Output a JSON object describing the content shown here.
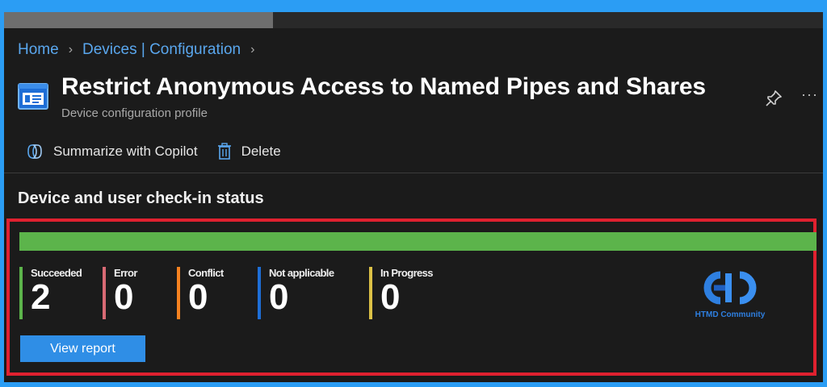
{
  "breadcrumb": [
    "Home",
    "Devices | Configuration"
  ],
  "header": {
    "title": "Restrict Anonymous Access to Named Pipes and Shares",
    "subtitle": "Device configuration profile",
    "more": "···"
  },
  "toolbar": {
    "copilot_label": "Summarize with Copilot",
    "delete_label": "Delete"
  },
  "section": {
    "title": "Device and user check-in status"
  },
  "status": {
    "progress_succeeded_fraction": 1.0,
    "stats": [
      {
        "label": "Succeeded",
        "value": "2",
        "color": "#5cb44b"
      },
      {
        "label": "Error",
        "value": "0",
        "color": "#d86a74"
      },
      {
        "label": "Conflict",
        "value": "0",
        "color": "#f58220"
      },
      {
        "label": "Not applicable",
        "value": "0",
        "color": "#1e6ed6"
      },
      {
        "label": "In Progress",
        "value": "0",
        "color": "#dcc146"
      }
    ],
    "view_report_label": "View report"
  },
  "watermark": {
    "text": "HTMD Community"
  },
  "colors": {
    "accent": "#2f8ee6",
    "highlight_border": "#e0212f",
    "background": "#1b1b1b"
  }
}
